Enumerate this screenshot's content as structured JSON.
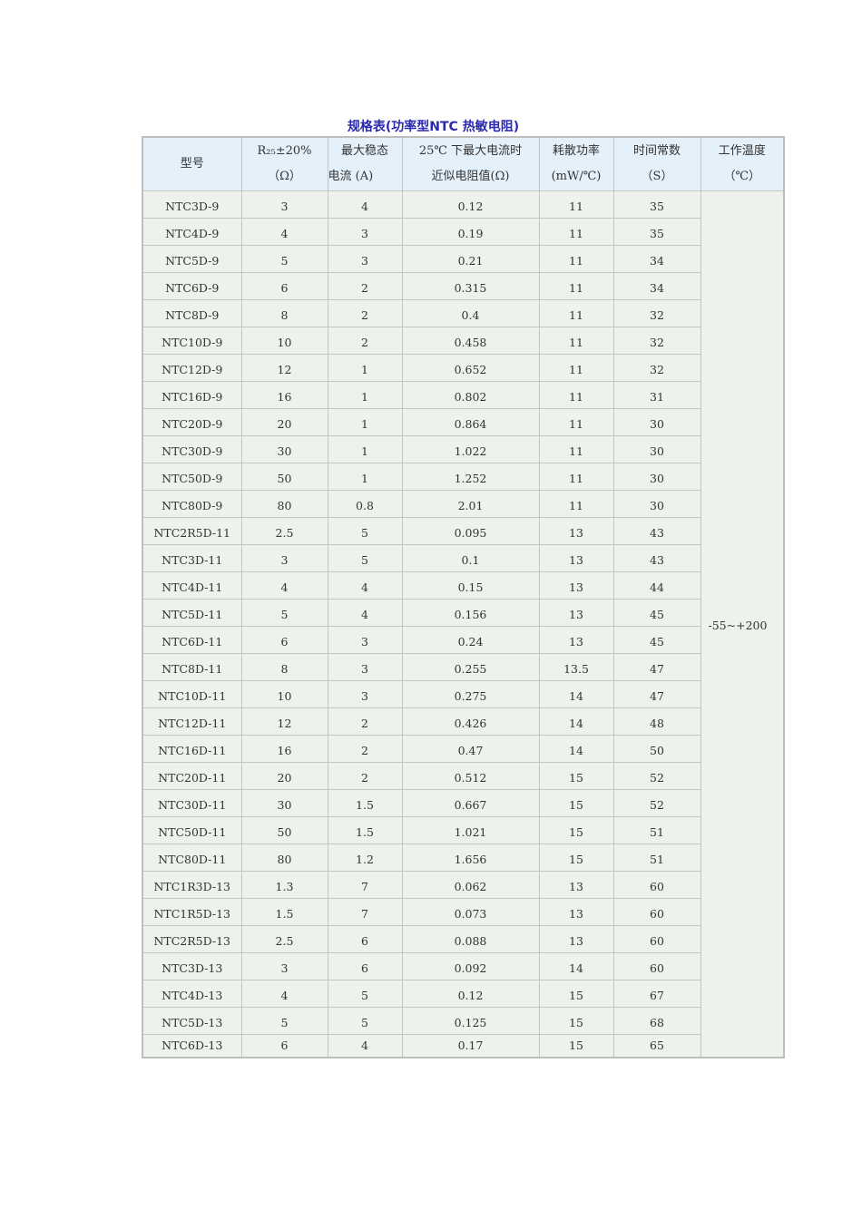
{
  "title": "规格表(功率型NTC 热敏电阻)",
  "headers": [
    [
      "型号",
      ""
    ],
    [
      "R₂₅±20%",
      "（Ω）"
    ],
    [
      "最大稳态",
      "电流 (A)"
    ],
    [
      "25℃ 下最大电流时",
      "近似电阻值(Ω)"
    ],
    [
      "耗散功率",
      "(mW/℃)"
    ],
    [
      "时间常数",
      "（S）"
    ],
    [
      "工作温度",
      "（℃）"
    ]
  ],
  "temperature": "-55~+200",
  "rows": [
    [
      "NTC3D-9",
      "3",
      "4",
      "0.12",
      "11",
      "35"
    ],
    [
      "NTC4D-9",
      "4",
      "3",
      "0.19",
      "11",
      "35"
    ],
    [
      "NTC5D-9",
      "5",
      "3",
      "0.21",
      "11",
      "34"
    ],
    [
      "NTC6D-9",
      "6",
      "2",
      "0.315",
      "11",
      "34"
    ],
    [
      "NTC8D-9",
      "8",
      "2",
      "0.4",
      "11",
      "32"
    ],
    [
      "NTC10D-9",
      "10",
      "2",
      "0.458",
      "11",
      "32"
    ],
    [
      "NTC12D-9",
      "12",
      "1",
      "0.652",
      "11",
      "32"
    ],
    [
      "NTC16D-9",
      "16",
      "1",
      "0.802",
      "11",
      "31"
    ],
    [
      "NTC20D-9",
      "20",
      "1",
      "0.864",
      "11",
      "30"
    ],
    [
      "NTC30D-9",
      "30",
      "1",
      "1.022",
      "11",
      "30"
    ],
    [
      "NTC50D-9",
      "50",
      "1",
      "1.252",
      "11",
      "30"
    ],
    [
      "NTC80D-9",
      "80",
      "0.8",
      "2.01",
      "11",
      "30"
    ],
    [
      "NTC2R5D-11",
      "2.5",
      "5",
      "0.095",
      "13",
      "43"
    ],
    [
      "NTC3D-11",
      "3",
      "5",
      "0.1",
      "13",
      "43"
    ],
    [
      "NTC4D-11",
      "4",
      "4",
      "0.15",
      "13",
      "44"
    ],
    [
      "NTC5D-11",
      "5",
      "4",
      "0.156",
      "13",
      "45"
    ],
    [
      "NTC6D-11",
      "6",
      "3",
      "0.24",
      "13",
      "45"
    ],
    [
      "NTC8D-11",
      "8",
      "3",
      "0.255",
      "13.5",
      "47"
    ],
    [
      "NTC10D-11",
      "10",
      "3",
      "0.275",
      "14",
      "47"
    ],
    [
      "NTC12D-11",
      "12",
      "2",
      "0.426",
      "14",
      "48"
    ],
    [
      "NTC16D-11",
      "16",
      "2",
      "0.47",
      "14",
      "50"
    ],
    [
      "NTC20D-11",
      "20",
      "2",
      "0.512",
      "15",
      "52"
    ],
    [
      "NTC30D-11",
      "30",
      "1.5",
      "0.667",
      "15",
      "52"
    ],
    [
      "NTC50D-11",
      "50",
      "1.5",
      "1.021",
      "15",
      "51"
    ],
    [
      "NTC80D-11",
      "80",
      "1.2",
      "1.656",
      "15",
      "51"
    ],
    [
      "NTC1R3D-13",
      "1.3",
      "7",
      "0.062",
      "13",
      "60"
    ],
    [
      "NTC1R5D-13",
      "1.5",
      "7",
      "0.073",
      "13",
      "60"
    ],
    [
      "NTC2R5D-13",
      "2.5",
      "6",
      "0.088",
      "13",
      "60"
    ],
    [
      "NTC3D-13",
      "3",
      "6",
      "0.092",
      "14",
      "60"
    ],
    [
      "NTC4D-13",
      "4",
      "5",
      "0.12",
      "15",
      "67"
    ],
    [
      "NTC5D-13",
      "5",
      "5",
      "0.125",
      "15",
      "68"
    ],
    [
      "NTC6D-13",
      "6",
      "4",
      "0.17",
      "15",
      "65"
    ]
  ]
}
